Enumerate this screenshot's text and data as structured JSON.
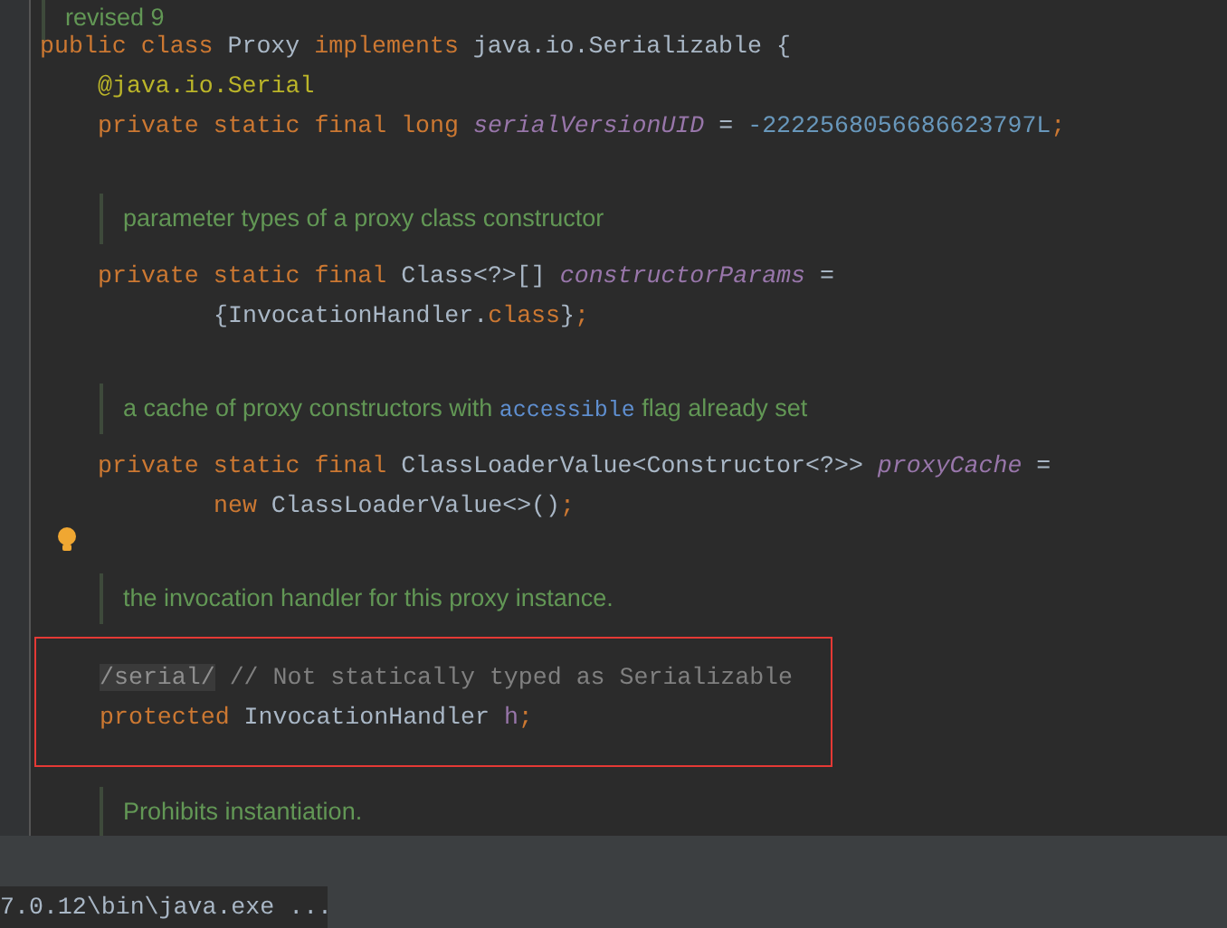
{
  "editor": {
    "items": [
      {
        "kind": "doc",
        "tokens": [
          {
            "kind": "text",
            "text": "revised 9"
          }
        ]
      },
      {
        "kind": "code",
        "tokens": [
          {
            "kind": "kw",
            "text": "public class "
          },
          {
            "kind": "plain",
            "text": "Proxy "
          },
          {
            "kind": "kw",
            "text": "implements "
          },
          {
            "kind": "plain",
            "text": "java.io.Serializable {"
          }
        ],
        "children": [
          {
            "kind": "code",
            "tokens": [
              {
                "kind": "ann",
                "text": "@java.io.Serial"
              }
            ]
          },
          {
            "kind": "code",
            "tokens": [
              {
                "kind": "kw",
                "text": "private static final long "
              },
              {
                "kind": "field",
                "text": "serialVersionUID"
              },
              {
                "kind": "plain",
                "text": " = "
              },
              {
                "kind": "num",
                "text": "-2222568056686623797L"
              },
              {
                "kind": "kw",
                "text": ";"
              }
            ]
          },
          {
            "kind": "doc",
            "tokens": [
              {
                "kind": "text",
                "text": "parameter types of a proxy class constructor"
              }
            ]
          },
          {
            "kind": "code",
            "tokens": [
              {
                "kind": "kw",
                "text": "private static final "
              },
              {
                "kind": "plain",
                "text": "Class<?>[] "
              },
              {
                "kind": "field",
                "text": "constructorParams"
              },
              {
                "kind": "plain",
                "text": " ="
              }
            ],
            "children": [
              {
                "kind": "cont",
                "tokens": [
                  {
                    "kind": "plain",
                    "text": "{InvocationHandler."
                  },
                  {
                    "kind": "kw",
                    "text": "class"
                  },
                  {
                    "kind": "plain",
                    "text": "}"
                  },
                  {
                    "kind": "kw",
                    "text": ";"
                  }
                ]
              }
            ]
          },
          {
            "kind": "doc",
            "tokens": [
              {
                "kind": "text",
                "text": "a cache of proxy constructors with "
              },
              {
                "kind": "code",
                "text": "accessible"
              },
              {
                "kind": "text",
                "text": " flag already set"
              }
            ]
          },
          {
            "kind": "code",
            "tokens": [
              {
                "kind": "kw",
                "text": "private static final "
              },
              {
                "kind": "plain",
                "text": "ClassLoaderValue<Constructor<?>> "
              },
              {
                "kind": "field",
                "text": "proxyCache"
              },
              {
                "kind": "plain",
                "text": " ="
              }
            ],
            "children": [
              {
                "kind": "cont",
                "tokens": [
                  {
                    "kind": "kw",
                    "text": "new "
                  },
                  {
                    "kind": "plain",
                    "text": "ClassLoaderValue<>()"
                  },
                  {
                    "kind": "kw",
                    "text": ";"
                  }
                ]
              }
            ]
          },
          {
            "kind": "hint"
          },
          {
            "kind": "doc",
            "tokens": [
              {
                "kind": "text",
                "text": "the invocation handler for this proxy instance."
              }
            ]
          },
          {
            "kind": "box",
            "children": [
              {
                "kind": "code",
                "tokens": [
                  {
                    "kind": "marker",
                    "text": "/serial/"
                  },
                  {
                    "kind": "comment",
                    "text": " // Not statically typed as Serializable"
                  }
                ]
              },
              {
                "kind": "code",
                "tokens": [
                  {
                    "kind": "kw",
                    "text": "protected "
                  },
                  {
                    "kind": "plain",
                    "text": "InvocationHandler "
                  },
                  {
                    "kind": "member",
                    "text": "h"
                  },
                  {
                    "kind": "kw",
                    "text": ";"
                  }
                ]
              }
            ]
          },
          {
            "kind": "doc",
            "tokens": [
              {
                "kind": "text",
                "text": "Prohibits instantiation."
              }
            ]
          }
        ]
      }
    ]
  },
  "status_bar": {
    "text": "7.0.12\\bin\\java.exe ..."
  }
}
